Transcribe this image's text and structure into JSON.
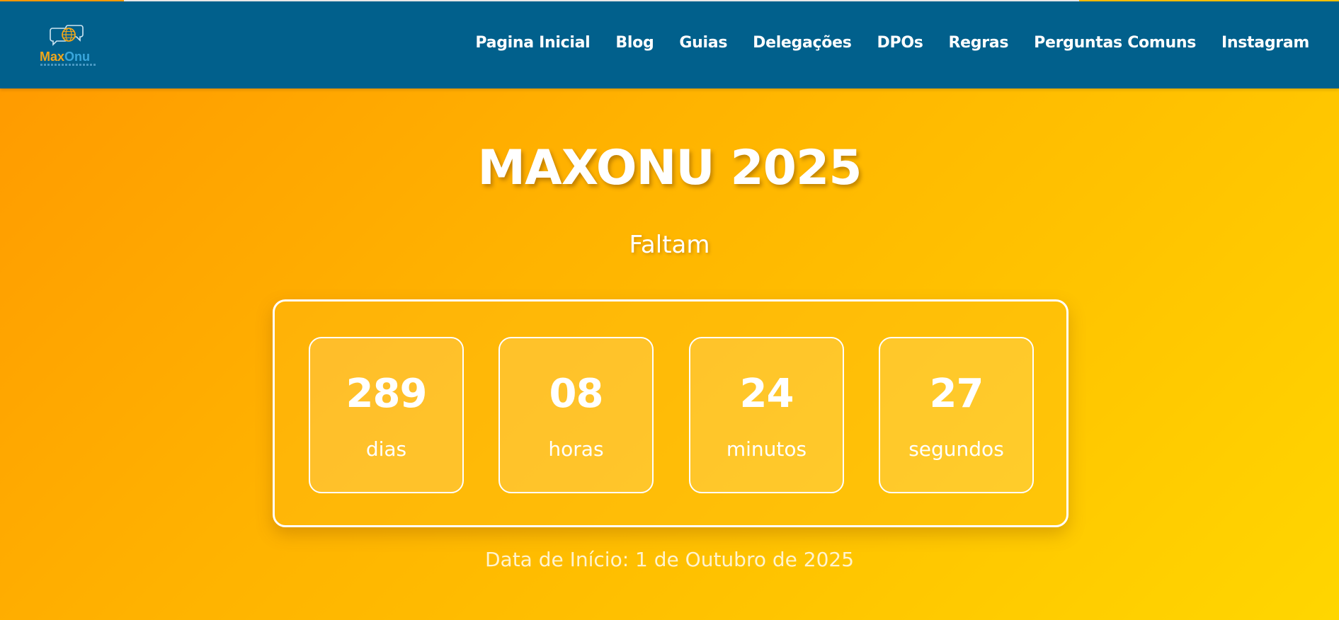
{
  "nav": {
    "logo": {
      "text_max": "Max",
      "text_onu": "Onu",
      "icon": "globe-speech-bubbles-icon",
      "colors": {
        "max": "#f2a71a",
        "onu": "#3aa7dd"
      }
    },
    "links": [
      {
        "label": "Pagina Inicial"
      },
      {
        "label": "Blog"
      },
      {
        "label": "Guias"
      },
      {
        "label": "Delegações"
      },
      {
        "label": "DPOs"
      },
      {
        "label": "Regras"
      },
      {
        "label": "Perguntas Comuns"
      },
      {
        "label": "Instagram"
      }
    ],
    "background": "#01608c"
  },
  "hero": {
    "title": "MAXONU 2025",
    "subtitle": "Faltam",
    "countdown": [
      {
        "value": "289",
        "label": "dias"
      },
      {
        "value": "08",
        "label": "horas"
      },
      {
        "value": "24",
        "label": "minutos"
      },
      {
        "value": "27",
        "label": "segundos"
      }
    ],
    "start_date": "Data de Início: 1 de Outubro de 2025",
    "gradient": [
      "#ff9800",
      "#ffd600"
    ]
  }
}
